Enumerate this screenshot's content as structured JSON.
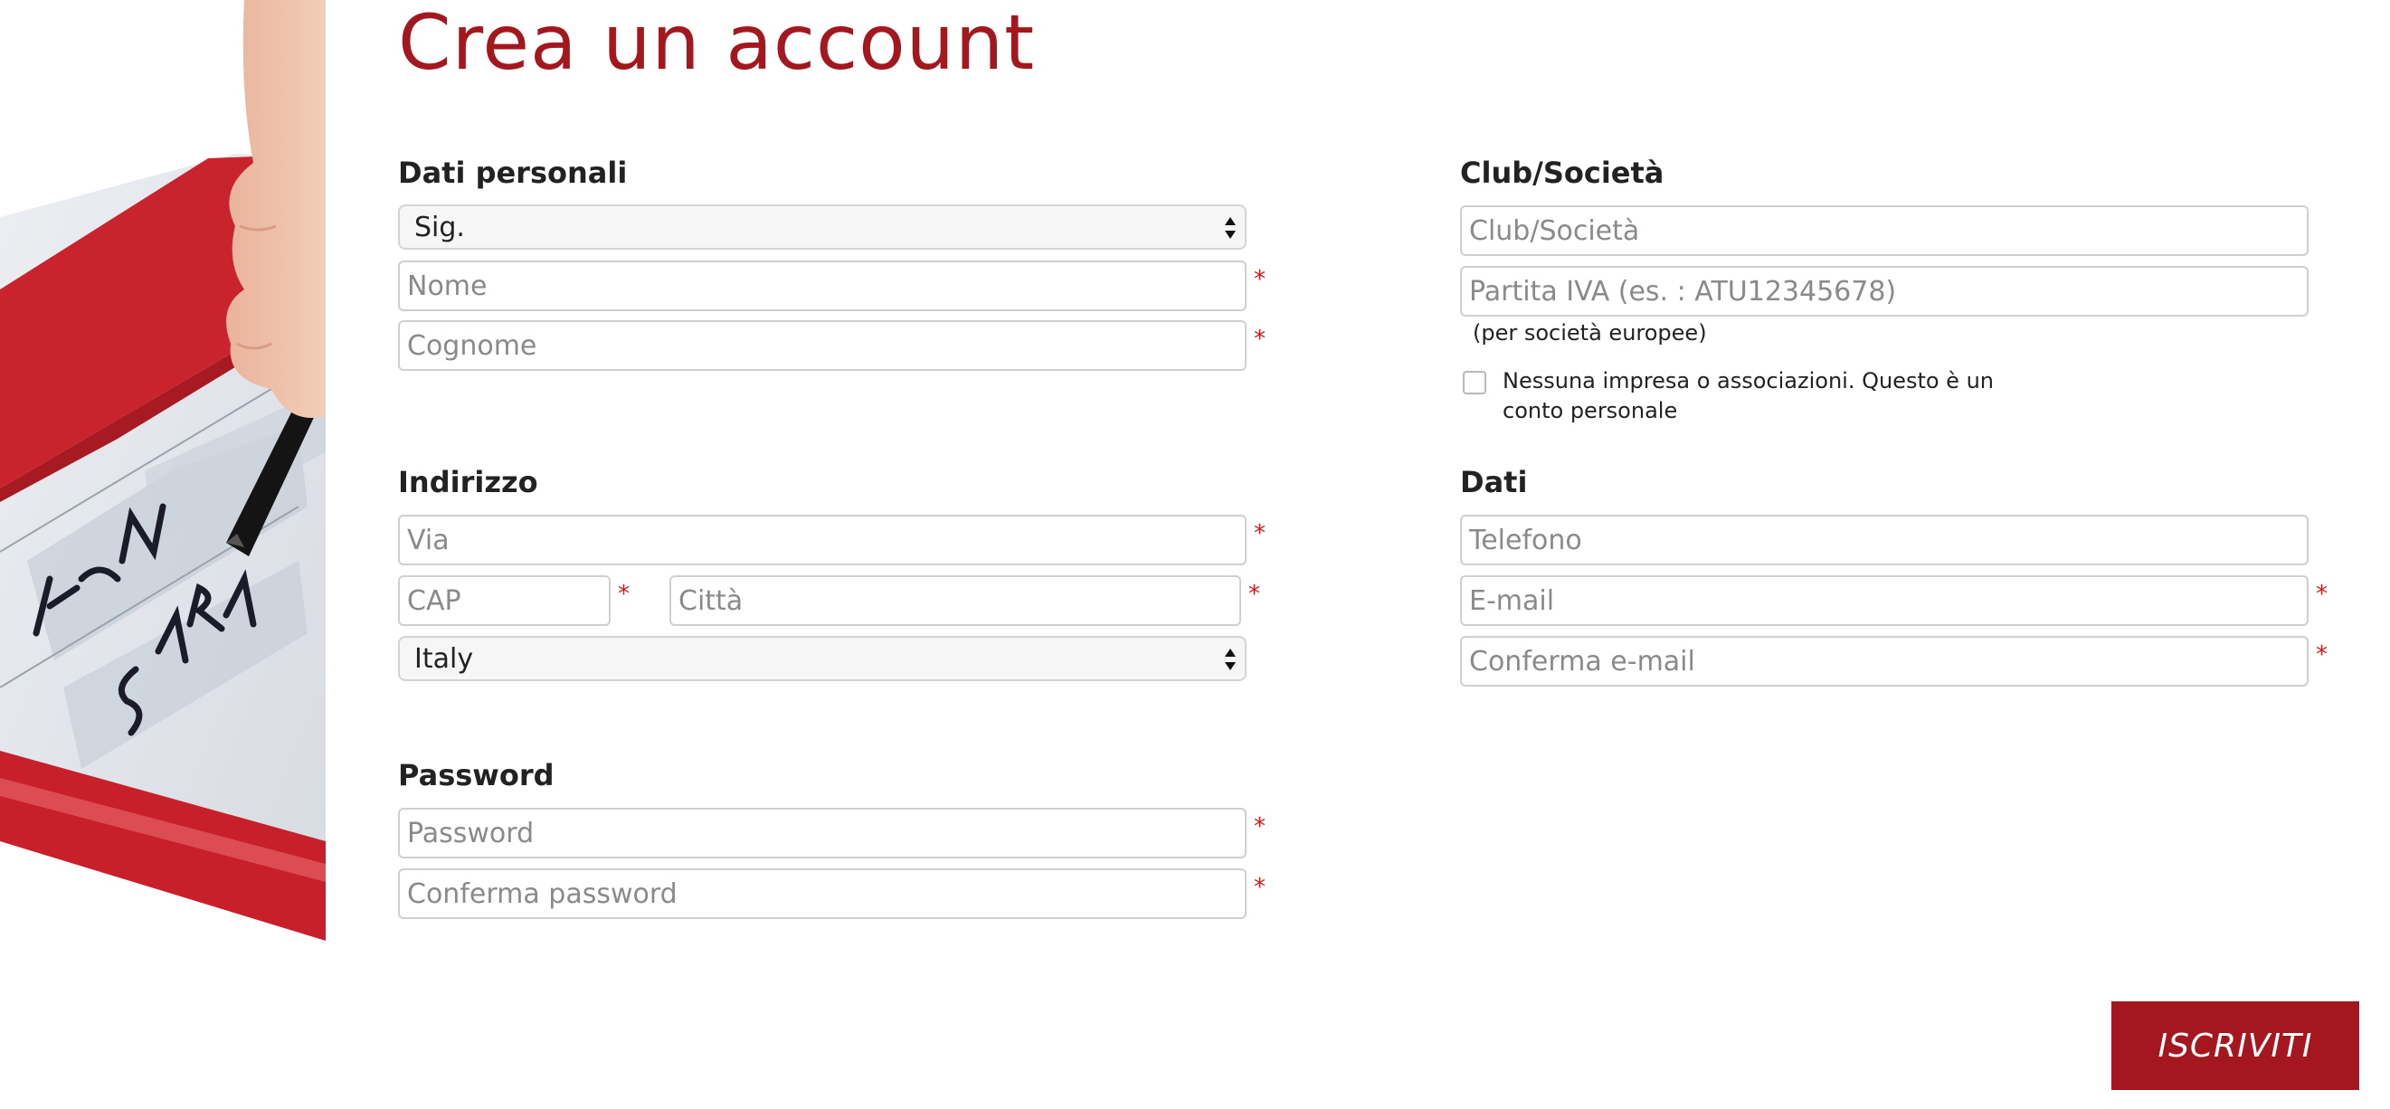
{
  "page": {
    "title": "Crea un account"
  },
  "personal": {
    "heading": "Dati personali",
    "salutation": "Sig.",
    "first_name_placeholder": "Nome",
    "last_name_placeholder": "Cognome"
  },
  "address": {
    "heading": "Indirizzo",
    "street_placeholder": "Via",
    "zip_placeholder": "CAP",
    "city_placeholder": "Città",
    "country": "Italy"
  },
  "password": {
    "heading": "Password",
    "password_placeholder": "Password",
    "confirm_placeholder": "Conferma password"
  },
  "company": {
    "heading": "Club/Società",
    "name_placeholder": "Club/Società",
    "vat_placeholder": "Partita IVA (es. : ATU12345678)",
    "vat_note": "(per società europee)",
    "private_checkbox_label": "Nessuna impresa o associazioni. Questo è un conto personale",
    "private_checkbox_checked": false
  },
  "contact": {
    "heading": "Dati",
    "phone_placeholder": "Telefono",
    "email_placeholder": "E-mail",
    "email_confirm_placeholder": "Conferma e-mail"
  },
  "required_marker": "*",
  "submit_label": "ISCRIVITI",
  "colors": {
    "accent": "#a5171e",
    "required": "#d11a1a",
    "field_border": "#cfcfcf"
  },
  "image": {
    "description_icon": "hand-writing-on-notepad-image"
  }
}
